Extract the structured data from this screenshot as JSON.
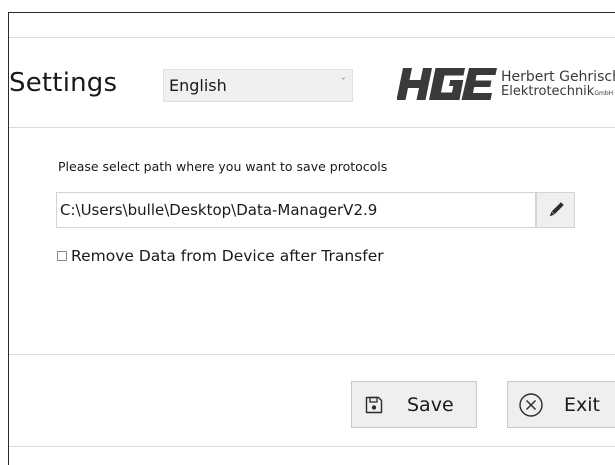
{
  "header": {
    "title": "Settings",
    "language": "English",
    "logo": {
      "mark": "HGE",
      "line1": "Herbert Gehrisch",
      "line2": "Elektrotechnik",
      "suffix": "GmbH"
    }
  },
  "path_section": {
    "label": "Please select path where you want to save protocols",
    "path_value": "C:\\Users\\bulle\\Desktop\\Data-ManagerV2.9"
  },
  "options": {
    "remove_after_transfer_label": "Remove Data from Device after Transfer",
    "remove_after_transfer_checked": false
  },
  "footer": {
    "save_label": "Save",
    "exit_label": "Exit"
  },
  "colors": {
    "logo": "#3a3a3a",
    "button_bg": "#efefef",
    "divider": "#dcdcdc"
  },
  "icons": {
    "edit": "pencil-icon",
    "save": "floppy-disk-icon",
    "exit": "close-circle-icon",
    "dropdown": "chevron-down-icon"
  }
}
